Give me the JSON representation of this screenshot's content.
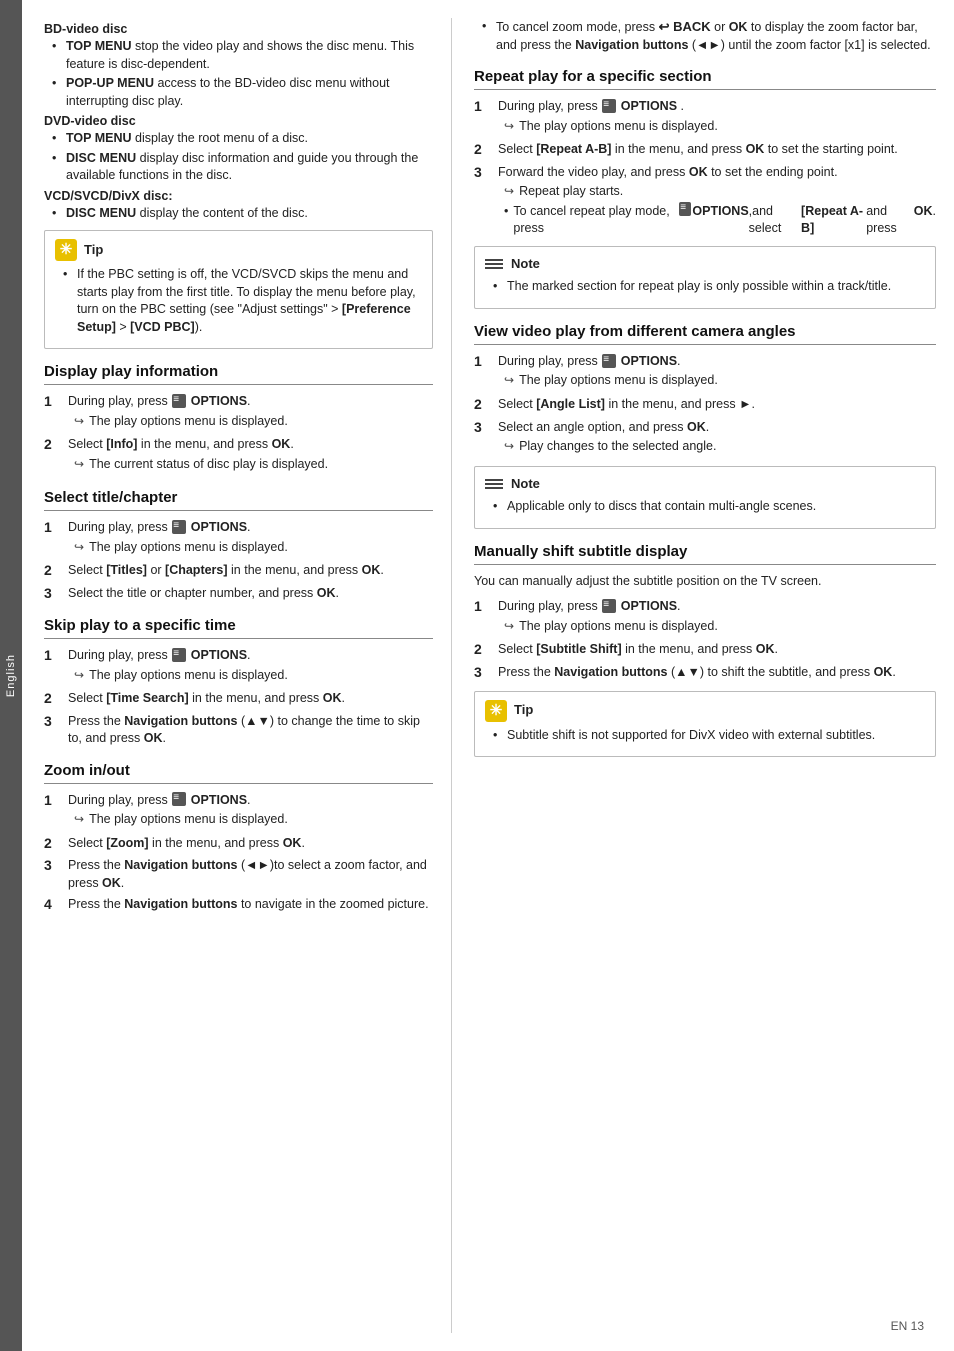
{
  "sidebar": {
    "language": "English"
  },
  "page_number": "EN  13",
  "left_col": {
    "bd_video_disc": {
      "heading": "BD-video disc",
      "items": [
        {
          "label": "TOP MENU",
          "label_bold": true,
          "text": " stop the video play and shows the disc menu. This feature is disc-dependent."
        },
        {
          "label": "POP-UP MENU",
          "label_bold": true,
          "text": " access to the BD-video disc menu without interrupting disc play."
        }
      ]
    },
    "dvd_video_disc": {
      "heading": "DVD-video disc",
      "items": [
        {
          "label": "TOP MENU",
          "label_bold": true,
          "text": " display the root menu of a disc."
        },
        {
          "label": "DISC MENU",
          "label_bold": true,
          "text": " display disc information and guide you through the available functions in the disc."
        }
      ]
    },
    "vcd_disc": {
      "heading": "VCD/SVCD/DivX disc:",
      "items": [
        {
          "label": "DISC MENU",
          "label_bold": true,
          "text": " display the content of the disc."
        }
      ]
    },
    "tip_box": {
      "header": "Tip",
      "content": "If the PBC setting is off, the VCD/SVCD skips the menu and starts play from the first title. To display the menu before play, turn on the PBC setting (see \"Adjust settings\" > [Preference Setup] > [VCD PBC])."
    },
    "display_play_info": {
      "title": "Display play information",
      "steps": [
        {
          "num": "1",
          "text": "During play, press ",
          "icon": true,
          "icon_text": "OPTIONS",
          "suffix": ".",
          "arrow": "The play options menu is displayed."
        },
        {
          "num": "2",
          "text": "Select ",
          "bold_part": "[Info]",
          "rest": " in the menu, and press ",
          "ok": "OK",
          "suffix": ".",
          "arrow": "The current status of disc play is displayed."
        }
      ]
    },
    "select_title_chapter": {
      "title": "Select title/chapter",
      "steps": [
        {
          "num": "1",
          "text": "During play, press ",
          "icon": true,
          "icon_text": "OPTIONS",
          "suffix": ".",
          "arrow": "The play options menu is displayed."
        },
        {
          "num": "2",
          "text": "Select ",
          "bold_part": "[Titles]",
          "rest": " or ",
          "bold_part2": "[Chapters]",
          "rest2": " in the menu, and press ",
          "ok": "OK",
          "suffix": "."
        },
        {
          "num": "3",
          "text": "Select the title or chapter number, and press ",
          "ok": "OK",
          "suffix": "."
        }
      ]
    },
    "skip_play_time": {
      "title": "Skip play to a specific time",
      "steps": [
        {
          "num": "1",
          "text": "During play, press ",
          "icon": true,
          "icon_text": "OPTIONS",
          "suffix": ".",
          "arrow": "The play options menu is displayed."
        },
        {
          "num": "2",
          "text": "Select ",
          "bold_part": "[Time Search]",
          "rest": " in the menu, and press ",
          "ok": "OK",
          "suffix": "."
        },
        {
          "num": "3",
          "text": "Press the ",
          "bold_part": "Navigation buttons",
          "rest": " (▲▼) to change the time to skip to, and press ",
          "ok": "OK",
          "suffix": "."
        }
      ]
    },
    "zoom_inout": {
      "title": "Zoom in/out",
      "steps": [
        {
          "num": "1",
          "text": "During play, press ",
          "icon": true,
          "icon_text": "OPTIONS",
          "suffix": ".",
          "arrow": "The play options menu is displayed."
        },
        {
          "num": "2",
          "text": "Select ",
          "bold_part": "[Zoom]",
          "rest": " in the menu, and press ",
          "ok": "OK",
          "suffix": "."
        },
        {
          "num": "3",
          "text": "Press the ",
          "bold_part": "Navigation buttons",
          "rest": " (◄►)to select a zoom factor, and press ",
          "ok": "OK",
          "suffix": "."
        },
        {
          "num": "4",
          "text": "Press the ",
          "bold_part": "Navigation buttons",
          "rest": " to navigate in the zoomed picture.",
          "suffix": ""
        }
      ]
    }
  },
  "right_col": {
    "zoom_cancel_note": {
      "bullet": "To cancel zoom mode, press ",
      "back_icon": true,
      "back_text": "BACK",
      "rest": " or ",
      "ok": "OK",
      "rest2": " to display the zoom factor bar, and press the ",
      "bold_part": "Navigation buttons",
      "rest3": " (◄►) until the zoom factor [x1] is selected."
    },
    "repeat_play_section": {
      "title": "Repeat play for a specific section",
      "steps": [
        {
          "num": "1",
          "text": "During play, press ",
          "icon": true,
          "icon_text": "OPTIONS",
          "suffix": " .",
          "arrow": "The play options menu is displayed."
        },
        {
          "num": "2",
          "text": "Select ",
          "bold_part": "[Repeat A-B]",
          "rest": " in the menu, and press ",
          "ok": "OK",
          "rest2": " to set the starting point.",
          "suffix": ""
        },
        {
          "num": "3",
          "text": "Forward the video play, and press ",
          "ok": "OK",
          "rest": " to set the ending point.",
          "suffix": "",
          "sub_bullets": [
            "Repeat play starts.",
            "To cancel repeat play mode, press  OPTIONS ,and select [Repeat A-B] and press OK."
          ]
        }
      ],
      "note": {
        "header": "Note",
        "content": "The marked section for repeat play is only possible within a track/title."
      }
    },
    "view_video_camera": {
      "title": "View video play from different camera angles",
      "steps": [
        {
          "num": "1",
          "text": "During play, press ",
          "icon": true,
          "icon_text": "OPTIONS",
          "suffix": ".",
          "arrow": "The play options menu is displayed."
        },
        {
          "num": "2",
          "text": "Select ",
          "bold_part": "[Angle List]",
          "rest": " in the menu, and press ►.",
          "suffix": ""
        },
        {
          "num": "3",
          "text": "Select an angle option, and press ",
          "ok": "OK",
          "suffix": ".",
          "arrow": "Play changes to the selected angle."
        }
      ],
      "note": {
        "header": "Note",
        "content": "Applicable only to discs that contain multi-angle scenes."
      }
    },
    "manually_shift_subtitle": {
      "title": "Manually shift subtitle display",
      "intro": "You can manually adjust the subtitle position on the TV screen.",
      "steps": [
        {
          "num": "1",
          "text": "During play, press ",
          "icon": true,
          "icon_text": "OPTIONS",
          "suffix": ".",
          "arrow": "The play options menu is displayed."
        },
        {
          "num": "2",
          "text": "Select ",
          "bold_part": "[Subtitle Shift]",
          "rest": " in the menu, and press ",
          "ok": "OK",
          "suffix": "."
        },
        {
          "num": "3",
          "text": "Press the ",
          "bold_part": "Navigation buttons",
          "rest": " (▲▼) to shift the subtitle, and press ",
          "ok": "OK",
          "suffix": "."
        }
      ],
      "tip": {
        "header": "Tip",
        "content": "Subtitle shift is not supported for DivX video with external subtitles."
      }
    }
  }
}
